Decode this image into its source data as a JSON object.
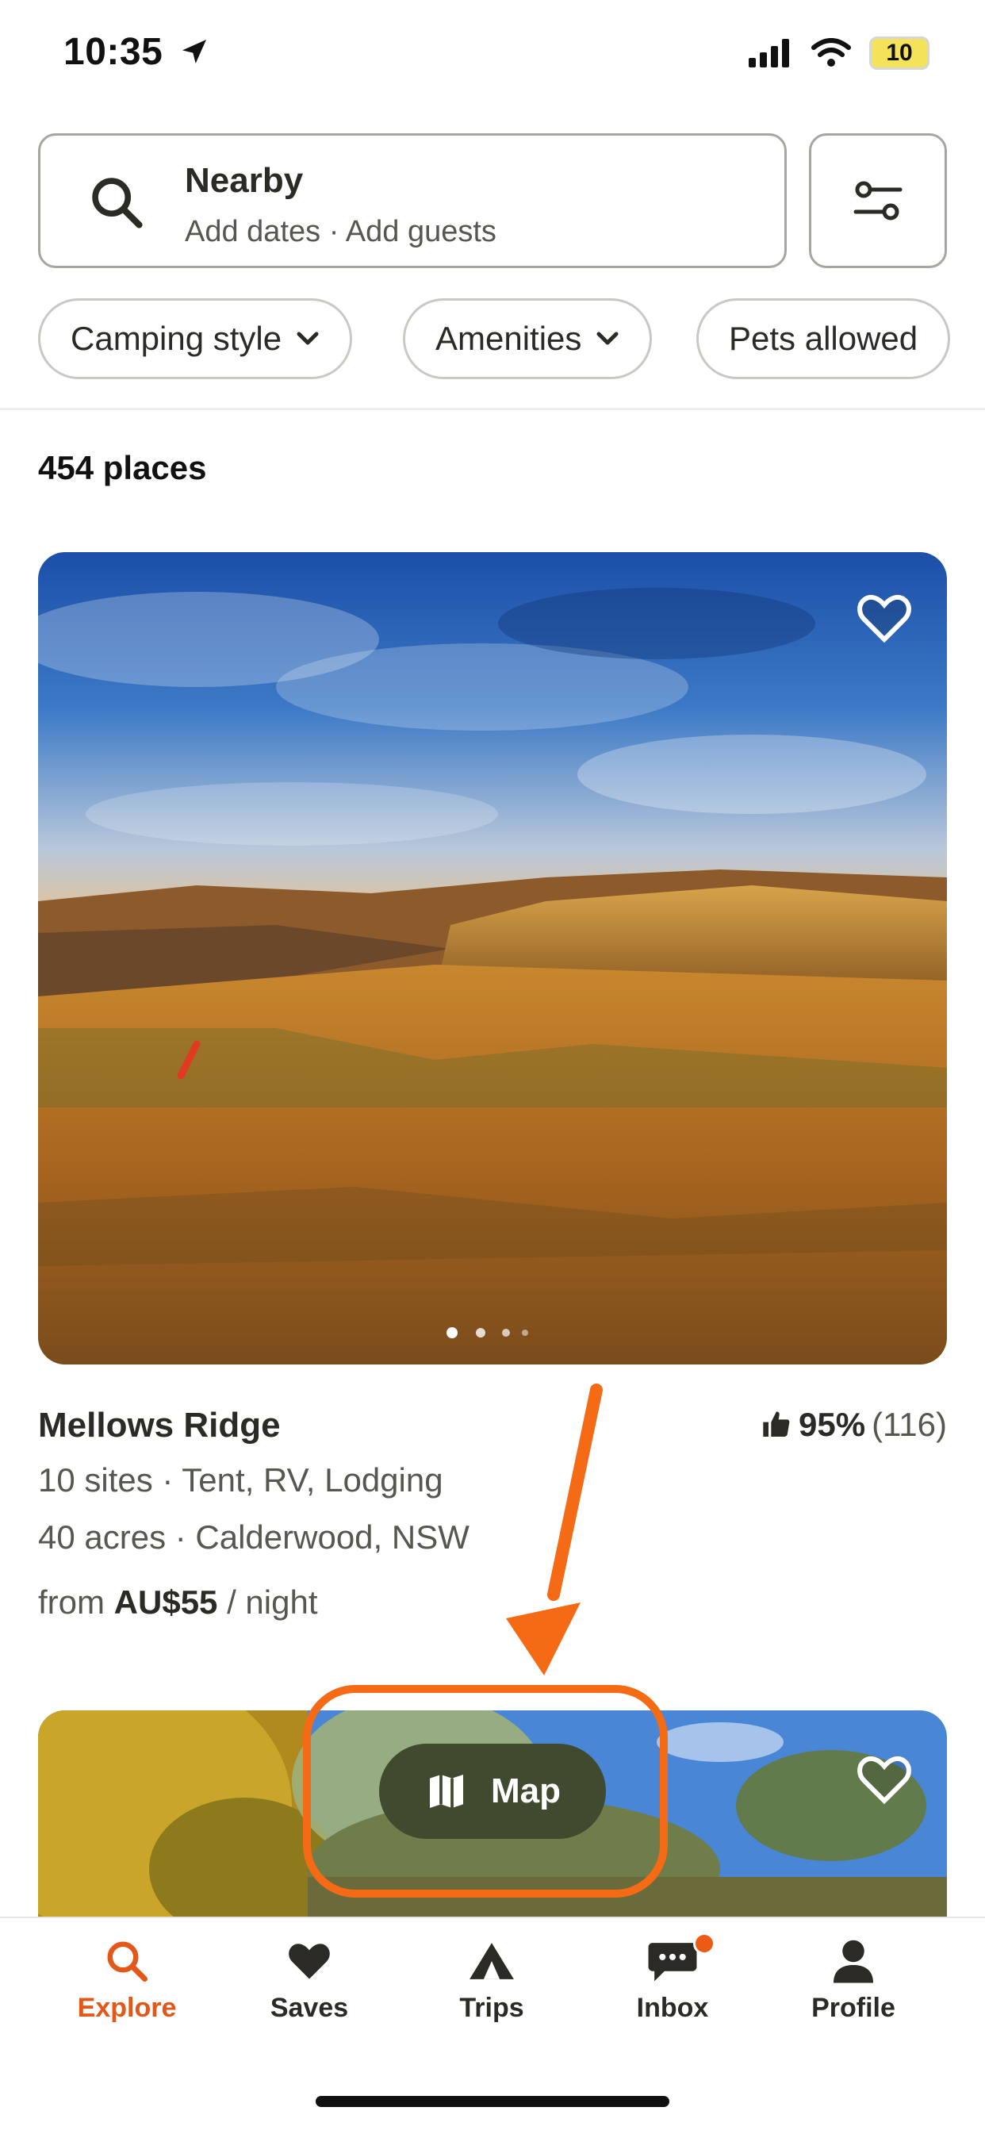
{
  "status_bar": {
    "time": "10:35",
    "battery": "10"
  },
  "search": {
    "title": "Nearby",
    "subtitle": "Add dates · Add guests"
  },
  "chips": [
    "Camping style",
    "Amenities",
    "Pets allowed"
  ],
  "results": {
    "count_label": "454 places"
  },
  "listing": {
    "name": "Mellows Ridge",
    "rating_percent": "95%",
    "rating_count": "(116)",
    "line1": "10 sites · Tent, RV, Lodging",
    "line2": "40 acres · Calderwood, NSW",
    "price_prefix": "from",
    "price": "AU$55",
    "price_suffix": "/ night",
    "photo_index": 1,
    "photo_count": 4
  },
  "map_button": {
    "label": "Map"
  },
  "nav": {
    "items": [
      {
        "label": "Explore",
        "icon": "search-icon",
        "active": true
      },
      {
        "label": "Saves",
        "icon": "heart-icon"
      },
      {
        "label": "Trips",
        "icon": "tent-icon"
      },
      {
        "label": "Inbox",
        "icon": "chat-icon",
        "badge": true
      },
      {
        "label": "Profile",
        "icon": "profile-icon"
      }
    ]
  },
  "colors": {
    "accent": "#e4571b",
    "map_pill": "#3f4a2e",
    "annotation": "#f56a14"
  }
}
